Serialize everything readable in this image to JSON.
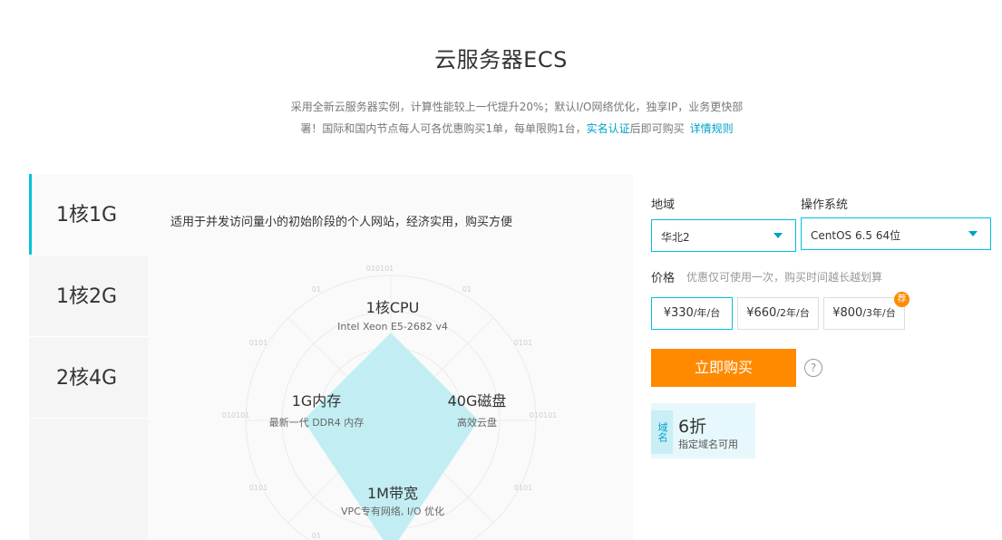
{
  "page": {
    "title": "云服务器ECS",
    "intro_line1": "采用全新云服务器实例，计算性能较上一代提升20%；默认I/O网络优化，独享IP，业务更快部",
    "intro_line2_pre": "署！国际和国内节点每人可各优惠购买1单，每单限购1台，",
    "intro_link_realname": "实名认证",
    "intro_line2_post": "后即可购买",
    "intro_link_rules": "详情规则"
  },
  "plans": [
    {
      "label": "1核1G",
      "active": true
    },
    {
      "label": "1核2G",
      "active": false
    },
    {
      "label": "2核4G",
      "active": false
    }
  ],
  "detail": {
    "description": "适用于并发访问量小的初始阶段的个人网站，经济实用，购买方便",
    "axes": [
      {
        "title": "1核CPU",
        "sub": "Intel Xeon E5-2682 v4"
      },
      {
        "title": "40G磁盘",
        "sub": "高效云盘"
      },
      {
        "title": "1M带宽",
        "sub": "VPC专有网络, I/O 优化"
      },
      {
        "title": "1G内存",
        "sub": "最新一代 DDR4 内存"
      }
    ],
    "decor": {
      "top": "010101",
      "left": "010101",
      "right": "010101",
      "small_a": "01",
      "small_b": "0101"
    }
  },
  "chart_data": {
    "type": "radar",
    "categories": [
      "1核CPU",
      "40G磁盘",
      "1M带宽",
      "1G内存"
    ],
    "values": [
      0.6,
      0.6,
      0.9,
      0.6
    ],
    "max": 1,
    "fill_color": "#c2eef3"
  },
  "form": {
    "region_label": "地域",
    "region_value": "华北2",
    "os_label": "操作系统",
    "os_value": "CentOS 6.5 64位",
    "price_label": "价格",
    "price_hint": "优惠仅可使用一次，购买时间越长越划算",
    "prices": [
      {
        "amount": "¥330",
        "unit": "/年/台",
        "active": true
      },
      {
        "amount": "¥660",
        "unit": "/2年/台",
        "active": false
      },
      {
        "amount": "¥800",
        "unit": "/3年/台",
        "active": false
      }
    ],
    "price_badge": "荐",
    "buy_label": "立即购买",
    "help_symbol": "?"
  },
  "promo": {
    "tag": "域名",
    "big": "6折",
    "small": "指定域名可用"
  },
  "colors": {
    "accent": "#00c1de",
    "link": "#00a2ca",
    "orange": "#ff8a00"
  }
}
